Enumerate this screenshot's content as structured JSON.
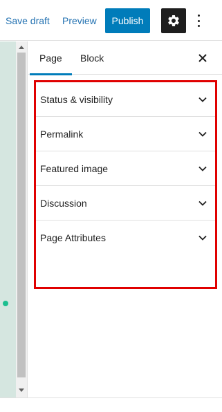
{
  "toolbar": {
    "save_draft": "Save draft",
    "preview": "Preview",
    "publish": "Publish",
    "settings_icon": "gear-icon",
    "more_icon": "more-vertical-icon"
  },
  "sidebar": {
    "tabs": [
      {
        "label": "Page",
        "active": true
      },
      {
        "label": "Block",
        "active": false
      }
    ],
    "close_icon": "close-icon",
    "panels": [
      {
        "title": "Status & visibility"
      },
      {
        "title": "Permalink"
      },
      {
        "title": "Featured image"
      },
      {
        "title": "Discussion"
      },
      {
        "title": "Page Attributes"
      }
    ]
  },
  "colors": {
    "accent": "#007cba",
    "highlight_border": "#e00000",
    "editor_background": "#d5e6e0"
  }
}
